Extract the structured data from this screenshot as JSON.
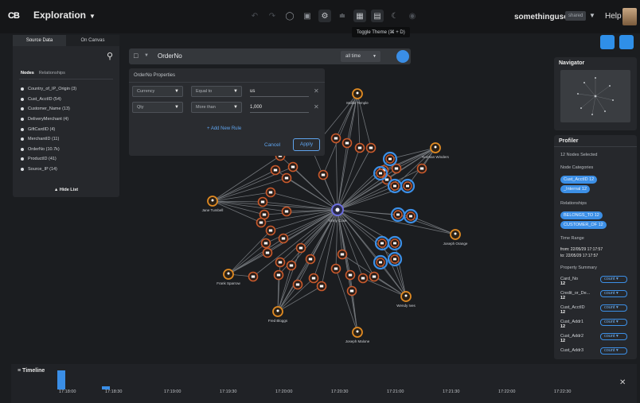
{
  "header": {
    "logo_text": "CB",
    "app_title": "Exploration",
    "workspace": "somethinguseful",
    "shared_badge": "shared",
    "help": "Help",
    "tooltip": "Toggle Theme (⌘ + D)"
  },
  "toolbar_icons": [
    "undo-icon",
    "redo-icon",
    "tag-icon",
    "image-icon",
    "filter-icon",
    "share-icon",
    "table-icon",
    "document-icon",
    "moon-icon",
    "camera-icon"
  ],
  "left_panel": {
    "tabs": [
      "Source Data",
      "On Canvas"
    ],
    "subtabs": [
      "Nodes",
      "Relationships"
    ],
    "items": [
      "Country_of_IP_Origin (3)",
      "Cust_AcctID (54)",
      "Customer_Name (13)",
      "DeliveryMerchant (4)",
      "GiftCardID (4)",
      "MerchantID (11)",
      "OrderNo (10.7k)",
      "ProductID (41)",
      "Source_IP (14)"
    ],
    "hide_list": "▲ Hide List"
  },
  "search": {
    "value": "OrderNo",
    "time": "all time"
  },
  "properties": {
    "title": "OrderNo Properties",
    "rules": [
      {
        "field": "Currency",
        "op": "Equal to",
        "value": "us"
      },
      {
        "field": "Qty",
        "op": "More than",
        "value": "1,000"
      }
    ],
    "add_rule": "+ Add New Rule",
    "cancel": "Cancel",
    "apply": "Apply"
  },
  "navigator": {
    "title": "Navigator"
  },
  "profiler": {
    "title": "Profiler",
    "selected": "12 Nodes Selected",
    "node_categories_label": "Node Categories",
    "node_categories": [
      "Cust_AcctID 12",
      "_Internal 12"
    ],
    "relationships_label": "Relationships",
    "relationships": [
      "BELONGS_TO 12",
      "CUSTOMER_OF 12"
    ],
    "time_range_label": "Time Range",
    "time_from": "from: 22/05/29 17:17:57",
    "time_to": "to: 22/05/29 17:17:57",
    "property_summary_label": "Property Summary",
    "properties": [
      {
        "name": "Card_No",
        "value": "12",
        "agg": "count"
      },
      {
        "name": "Credit_or_De...",
        "value": "12",
        "agg": "count"
      },
      {
        "name": "Cust_AcctID",
        "value": "12",
        "agg": "count"
      },
      {
        "name": "Cust_Addr1",
        "value": "12",
        "agg": "count"
      },
      {
        "name": "Cust_Addr2",
        "value": "12",
        "agg": "count"
      },
      {
        "name": "Cust_Addr3",
        "value": "",
        "agg": "count"
      }
    ]
  },
  "timeline": {
    "title": "Timeline",
    "ticks": [
      "17:18:00",
      "17:18:30",
      "17:19:00",
      "17:19:30",
      "17:20:00",
      "17:20:30",
      "17:21:00",
      "17:21:30",
      "17:22:00",
      "17:22:30"
    ]
  },
  "graph": {
    "center_label": "Vinny Coxe",
    "hub_labels": [
      "Mollie Temple",
      "Norman Winders",
      "Joseph Orange",
      "Wendy Ives",
      "Joseph Malone",
      "Fred Bloggs",
      "Frank Sparrow",
      "Jane Tumbell"
    ],
    "colors": {
      "order": "#c95a2c",
      "hub": "#e08a22",
      "selected": "#3c8fe6",
      "center": "#6c6fe0",
      "edge": "#8d9196"
    }
  }
}
